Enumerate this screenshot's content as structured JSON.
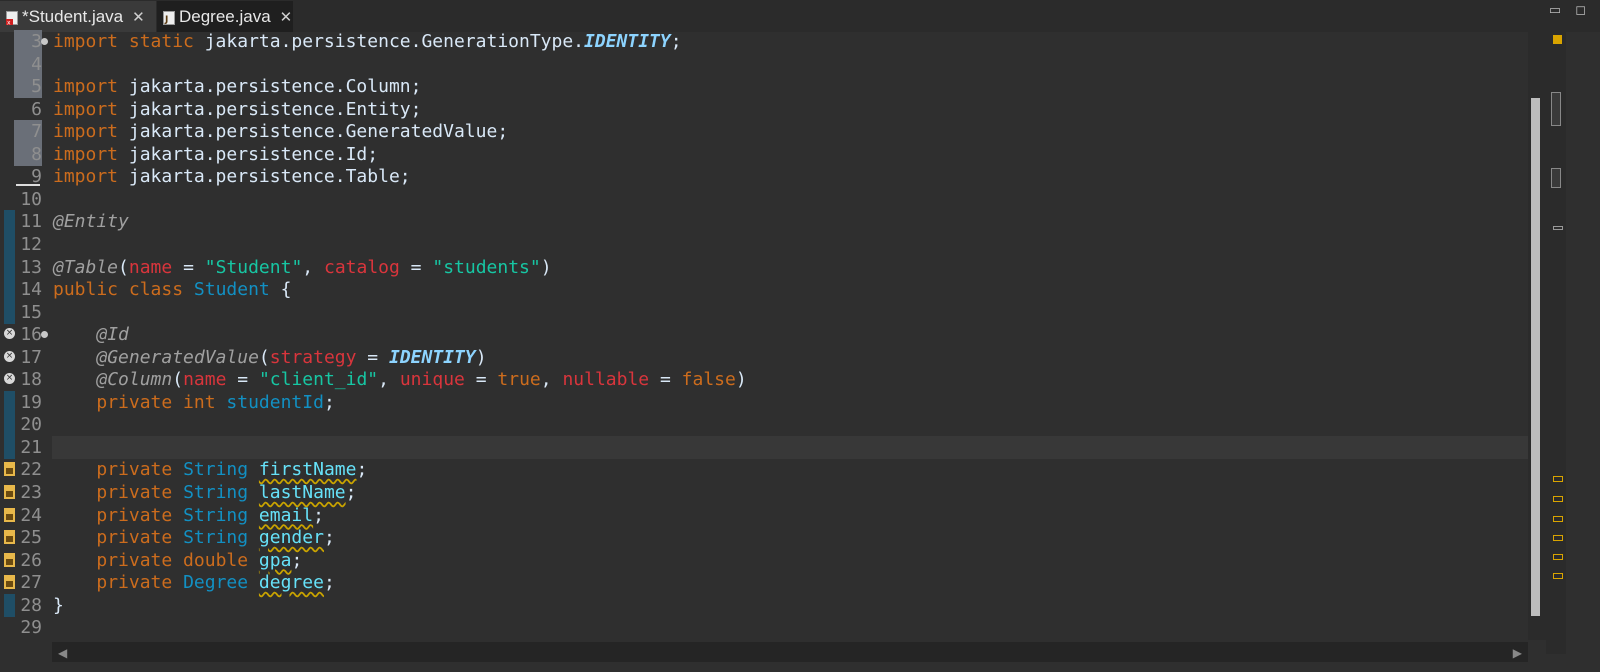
{
  "tabs": [
    {
      "label": "*Student.java",
      "active": false,
      "close": "✕",
      "icon": "java-file-error-icon"
    },
    {
      "label": "Degree.java",
      "active": true,
      "close": "✕",
      "icon": "java-file-icon"
    }
  ],
  "window_controls": {
    "minimize": "▭",
    "maximize": "◻"
  },
  "editor": {
    "current_line": "21",
    "lines": [
      {
        "n": "3",
        "tokens": [
          {
            "t": "kw",
            "v": "import static "
          },
          {
            "t": "plain",
            "v": "jakarta.persistence.GenerationType."
          },
          {
            "t": "const",
            "v": "IDENTITY"
          },
          {
            "t": "plain",
            "v": ";"
          }
        ],
        "fold": true,
        "quickdiff": true
      },
      {
        "n": "4",
        "tokens": [],
        "quickdiff": true
      },
      {
        "n": "5",
        "tokens": [
          {
            "t": "kw",
            "v": "import "
          },
          {
            "t": "plain",
            "v": "jakarta.persistence.Column;"
          }
        ],
        "quickdiff": true
      },
      {
        "n": "6",
        "tokens": [
          {
            "t": "kw",
            "v": "import "
          },
          {
            "t": "plain",
            "v": "jakarta.persistence.Entity;"
          }
        ]
      },
      {
        "n": "7",
        "tokens": [
          {
            "t": "kw",
            "v": "import "
          },
          {
            "t": "plain",
            "v": "jakarta.persistence.GeneratedValue;"
          }
        ],
        "quickdiff": true
      },
      {
        "n": "8",
        "tokens": [
          {
            "t": "kw",
            "v": "import "
          },
          {
            "t": "plain",
            "v": "jakarta.persistence.Id;"
          }
        ],
        "quickdiff": true
      },
      {
        "n": "9",
        "tokens": [
          {
            "t": "kw",
            "v": "import "
          },
          {
            "t": "plain",
            "v": "jakarta.persistence.Table;"
          }
        ]
      },
      {
        "n": "10",
        "tokens": []
      },
      {
        "n": "11",
        "tokens": [
          {
            "t": "ann",
            "v": "@Entity"
          }
        ],
        "changed": true
      },
      {
        "n": "12",
        "tokens": [],
        "changed": true
      },
      {
        "n": "13",
        "tokens": [
          {
            "t": "ann",
            "v": "@Table"
          },
          {
            "t": "plain",
            "v": "("
          },
          {
            "t": "attr",
            "v": "name"
          },
          {
            "t": "plain",
            "v": " = "
          },
          {
            "t": "str",
            "v": "\"Student\""
          },
          {
            "t": "plain",
            "v": ", "
          },
          {
            "t": "attr",
            "v": "catalog"
          },
          {
            "t": "plain",
            "v": " = "
          },
          {
            "t": "str",
            "v": "\"students\""
          },
          {
            "t": "plain",
            "v": ")"
          }
        ],
        "changed": true
      },
      {
        "n": "14",
        "tokens": [
          {
            "t": "kw",
            "v": "public class "
          },
          {
            "t": "typ",
            "v": "Student"
          },
          {
            "t": "plain",
            "v": " {"
          }
        ],
        "changed": true
      },
      {
        "n": "15",
        "tokens": [],
        "changed": true
      },
      {
        "n": "16",
        "tokens": [
          {
            "t": "plain",
            "v": "    "
          },
          {
            "t": "ann",
            "v": "@Id"
          }
        ],
        "fold": true,
        "error": true
      },
      {
        "n": "17",
        "tokens": [
          {
            "t": "plain",
            "v": "    "
          },
          {
            "t": "ann",
            "v": "@GeneratedValue"
          },
          {
            "t": "plain",
            "v": "("
          },
          {
            "t": "attr",
            "v": "strategy"
          },
          {
            "t": "plain",
            "v": " = "
          },
          {
            "t": "const",
            "v": "IDENTITY"
          },
          {
            "t": "plain",
            "v": ")"
          }
        ],
        "error": true
      },
      {
        "n": "18",
        "tokens": [
          {
            "t": "plain",
            "v": "    "
          },
          {
            "t": "ann",
            "v": "@Column"
          },
          {
            "t": "plain",
            "v": "("
          },
          {
            "t": "attr",
            "v": "name"
          },
          {
            "t": "plain",
            "v": " = "
          },
          {
            "t": "str",
            "v": "\"client_id\""
          },
          {
            "t": "plain",
            "v": ", "
          },
          {
            "t": "attr",
            "v": "unique"
          },
          {
            "t": "plain",
            "v": " = "
          },
          {
            "t": "bool",
            "v": "true"
          },
          {
            "t": "plain",
            "v": ", "
          },
          {
            "t": "attr",
            "v": "nullable"
          },
          {
            "t": "plain",
            "v": " = "
          },
          {
            "t": "bool",
            "v": "false"
          },
          {
            "t": "plain",
            "v": ")"
          }
        ],
        "error": true
      },
      {
        "n": "19",
        "tokens": [
          {
            "t": "plain",
            "v": "    "
          },
          {
            "t": "kw",
            "v": "private int "
          },
          {
            "t": "typ",
            "v": "studentId"
          },
          {
            "t": "plain",
            "v": ";"
          }
        ],
        "changed": true
      },
      {
        "n": "20",
        "tokens": [],
        "changed": true
      },
      {
        "n": "21",
        "tokens": [],
        "changed": true
      },
      {
        "n": "22",
        "tokens": [
          {
            "t": "plain",
            "v": "    "
          },
          {
            "t": "kw",
            "v": "private "
          },
          {
            "t": "typ",
            "v": "String "
          },
          {
            "t": "field",
            "v": "firstName"
          },
          {
            "t": "plain",
            "v": ";"
          }
        ],
        "warn": true
      },
      {
        "n": "23",
        "tokens": [
          {
            "t": "plain",
            "v": "    "
          },
          {
            "t": "kw",
            "v": "private "
          },
          {
            "t": "typ",
            "v": "String "
          },
          {
            "t": "field",
            "v": "lastName"
          },
          {
            "t": "plain",
            "v": ";"
          }
        ],
        "warn": true
      },
      {
        "n": "24",
        "tokens": [
          {
            "t": "plain",
            "v": "    "
          },
          {
            "t": "kw",
            "v": "private "
          },
          {
            "t": "typ",
            "v": "String "
          },
          {
            "t": "field",
            "v": "email"
          },
          {
            "t": "plain",
            "v": ";"
          }
        ],
        "warn": true
      },
      {
        "n": "25",
        "tokens": [
          {
            "t": "plain",
            "v": "    "
          },
          {
            "t": "kw",
            "v": "private "
          },
          {
            "t": "typ",
            "v": "String "
          },
          {
            "t": "field",
            "v": "gender"
          },
          {
            "t": "plain",
            "v": ";"
          }
        ],
        "warn": true
      },
      {
        "n": "26",
        "tokens": [
          {
            "t": "plain",
            "v": "    "
          },
          {
            "t": "kw",
            "v": "private double "
          },
          {
            "t": "field",
            "v": "gpa"
          },
          {
            "t": "plain",
            "v": ";"
          }
        ],
        "warn": true
      },
      {
        "n": "27",
        "tokens": [
          {
            "t": "plain",
            "v": "    "
          },
          {
            "t": "kw",
            "v": "private "
          },
          {
            "t": "typ",
            "v": "Degree "
          },
          {
            "t": "field",
            "v": "degree"
          },
          {
            "t": "plain",
            "v": ";"
          }
        ],
        "warn": true
      },
      {
        "n": "28",
        "tokens": [
          {
            "t": "plain",
            "v": "}"
          }
        ],
        "changed": true
      },
      {
        "n": "29",
        "tokens": []
      }
    ]
  },
  "colors": {
    "background": "#2f2f2f",
    "keyword": "#cc6c1d",
    "type": "#1290c3",
    "string": "#17c6a3",
    "annotation": "#a0a0a0",
    "attribute": "#d9353c",
    "constant": "#8dd4ff",
    "warning": "#d9a400"
  },
  "icons": {
    "error_marker": "error-circle-icon",
    "warning_marker": "warning-lightbulb-icon",
    "fold_marker": "fold-dot-icon",
    "scroll_left": "◀",
    "scroll_right": "▶"
  }
}
